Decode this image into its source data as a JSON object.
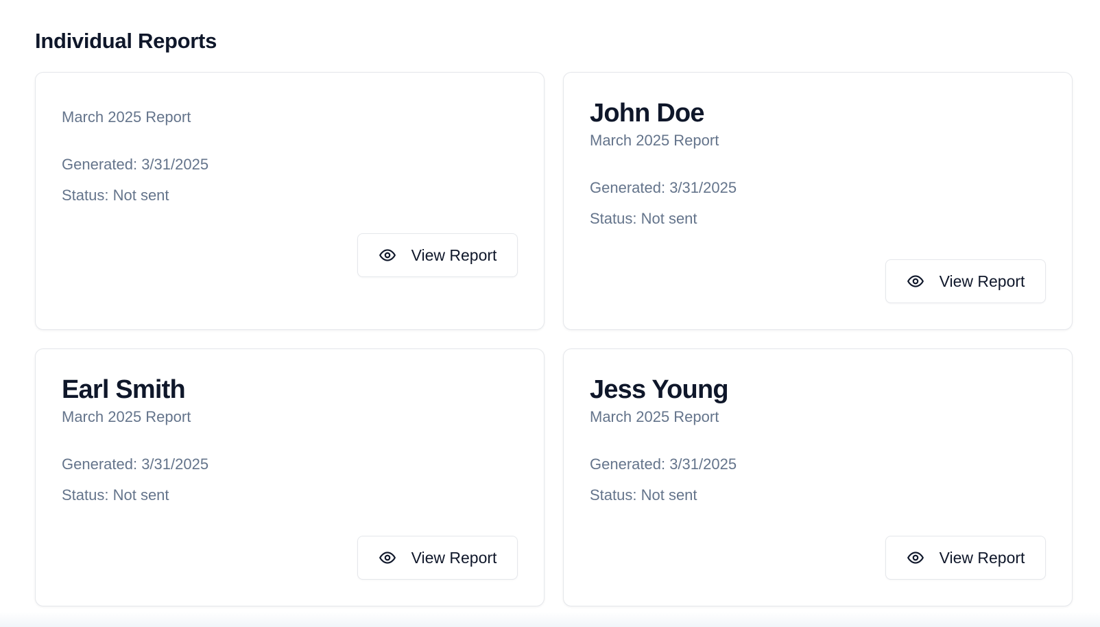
{
  "section": {
    "title": "Individual Reports"
  },
  "reports": [
    {
      "name": "",
      "period": "March 2025 Report",
      "generated": "Generated: 3/31/2025",
      "status": "Status: Not sent",
      "button_label": "View Report"
    },
    {
      "name": "John Doe",
      "period": "March 2025 Report",
      "generated": "Generated: 3/31/2025",
      "status": "Status: Not sent",
      "button_label": "View Report"
    },
    {
      "name": "Earl Smith",
      "period": "March 2025 Report",
      "generated": "Generated: 3/31/2025",
      "status": "Status: Not sent",
      "button_label": "View Report"
    },
    {
      "name": "Jess Young",
      "period": "March 2025 Report",
      "generated": "Generated: 3/31/2025",
      "status": "Status: Not sent",
      "button_label": "View Report"
    }
  ],
  "icons": {
    "view": "eye-icon"
  },
  "colors": {
    "text_primary": "#0f172a",
    "text_muted": "#64748b",
    "border": "#e5e7eb"
  }
}
